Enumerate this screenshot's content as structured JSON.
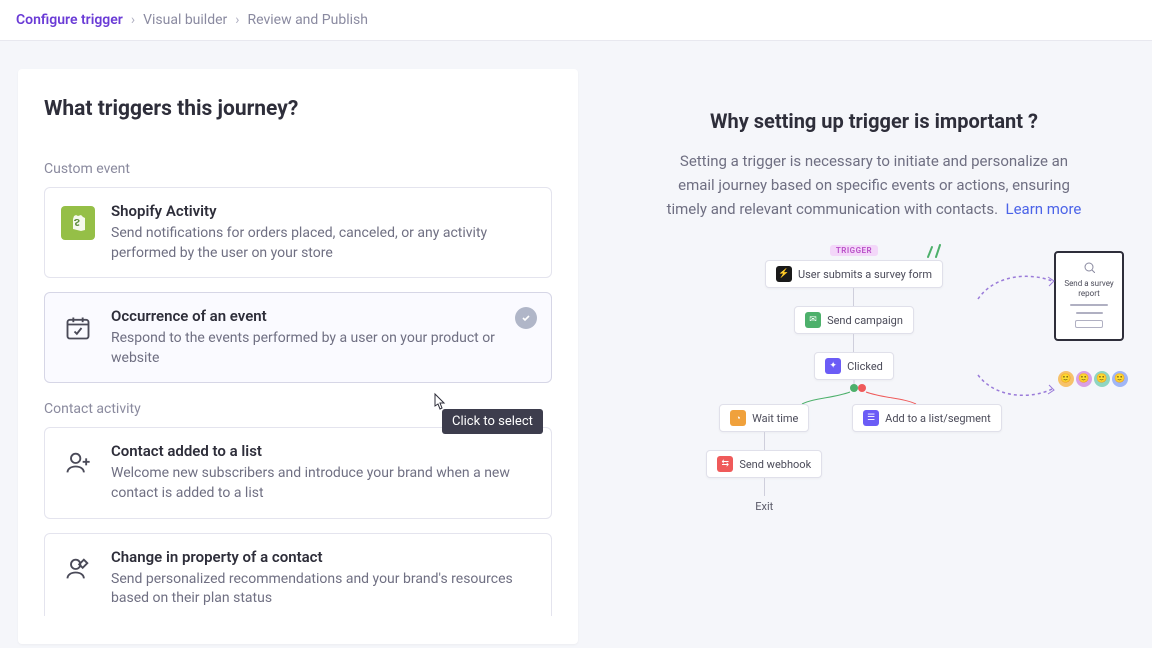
{
  "breadcrumb": {
    "items": [
      "Configure trigger",
      "Visual builder",
      "Review and Publish"
    ],
    "active_index": 0
  },
  "left": {
    "heading": "What triggers this journey?",
    "sections": [
      {
        "label": "Custom event",
        "cards": [
          {
            "id": "shopify-activity",
            "icon": "shopify",
            "title": "Shopify Activity",
            "desc": "Send notifications for orders placed, canceled, or any activity performed by the user on your store"
          },
          {
            "id": "occurrence-event",
            "icon": "calendar-event",
            "title": "Occurrence of an event",
            "desc": "Respond to the events performed by a user on your product or website",
            "hovered": true
          }
        ]
      },
      {
        "label": "Contact activity",
        "cards": [
          {
            "id": "contact-added-list",
            "icon": "person-plus",
            "title": "Contact added to a list",
            "desc": "Welcome new subscribers and introduce your brand when a new contact is added to a list"
          },
          {
            "id": "property-change",
            "icon": "person-edit",
            "title": "Change in property of a contact",
            "desc": "Send personalized recommendations and your brand's resources based on their plan status"
          }
        ]
      }
    ],
    "tooltip": "Click to select"
  },
  "right": {
    "heading": "Why setting up trigger is important ?",
    "desc": "Setting a trigger is necessary to initiate and personalize an email journey based on specific events or actions, ensuring timely and relevant communication with contacts.",
    "learn_more": "Learn more",
    "diagram": {
      "trigger_badge": "TRIGGER",
      "node_submit": "User submits a survey form",
      "node_campaign": "Send campaign",
      "node_clicked": "Clicked",
      "node_wait": "Wait time",
      "node_addlist": "Add to a list/segment",
      "node_webhook": "Send webhook",
      "exit": "Exit",
      "doc_label": "Send a survey report"
    }
  }
}
